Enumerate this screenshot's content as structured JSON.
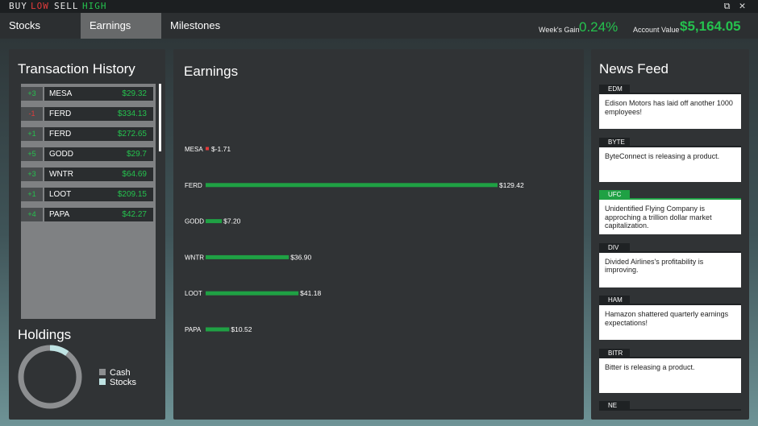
{
  "titlebar": {
    "word_buy": "BUY",
    "word_low": "LOW",
    "word_sell": "SELL",
    "word_high": "HIGH",
    "restore_icon": "⧉",
    "close_icon": "✕"
  },
  "nav": {
    "tabs": [
      {
        "label": "Stocks"
      },
      {
        "label": "Earnings",
        "active": true
      },
      {
        "label": "Milestones"
      }
    ],
    "weeks_gain_label": "Week's Gain",
    "weeks_gain_value": "0.24%",
    "account_value_label": "Account Value",
    "account_value": "$5,164.05"
  },
  "transactions": {
    "title": "Transaction History",
    "rows": [
      {
        "qty": "+3",
        "symbol": "MESA",
        "price": "$29.32"
      },
      {
        "qty": "-1",
        "symbol": "FERD",
        "price": "$334.13"
      },
      {
        "qty": "+1",
        "symbol": "FERD",
        "price": "$272.65"
      },
      {
        "qty": "+5",
        "symbol": "GODD",
        "price": "$29.7"
      },
      {
        "qty": "+3",
        "symbol": "WNTR",
        "price": "$64.69"
      },
      {
        "qty": "+1",
        "symbol": "LOOT",
        "price": "$209.15"
      },
      {
        "qty": "+4",
        "symbol": "PAPA",
        "price": "$42.27"
      }
    ]
  },
  "holdings": {
    "title": "Holdings",
    "legend": [
      {
        "label": "Cash",
        "color": "#8c8e90"
      },
      {
        "label": "Stocks",
        "color": "#bfe3e3"
      }
    ],
    "stocks_fraction": 0.1
  },
  "earnings": {
    "title": "Earnings",
    "chart_data": {
      "type": "bar",
      "orientation": "horizontal",
      "categories": [
        "MESA",
        "FERD",
        "GODD",
        "WNTR",
        "LOOT",
        "PAPA"
      ],
      "values": [
        -1.71,
        129.42,
        7.2,
        36.9,
        41.18,
        10.52
      ],
      "labels": [
        "$-1.71",
        "$129.42",
        "$7.20",
        "$36.90",
        "$41.18",
        "$10.52"
      ],
      "positive_color": "#1fa144",
      "negative_color": "#e23b3b"
    }
  },
  "news": {
    "title": "News Feed",
    "items": [
      {
        "ticker": "EDM",
        "text": "Edison Motors has laid off another 1000 employees!"
      },
      {
        "ticker": "BYTE",
        "text": "ByteConnect is releasing a product."
      },
      {
        "ticker": "UFC",
        "text": "Unidentified Flying Company is approching a trillion dollar market capitalization.",
        "highlight": true
      },
      {
        "ticker": "DIV",
        "text": "Divided Airlines's profitability is improving."
      },
      {
        "ticker": "HAM",
        "text": "Hamazon shattered quarterly earnings expectations!"
      },
      {
        "ticker": "BITR",
        "text": "Bitter is releasing a product."
      },
      {
        "ticker": "NE",
        "text": ""
      }
    ]
  }
}
